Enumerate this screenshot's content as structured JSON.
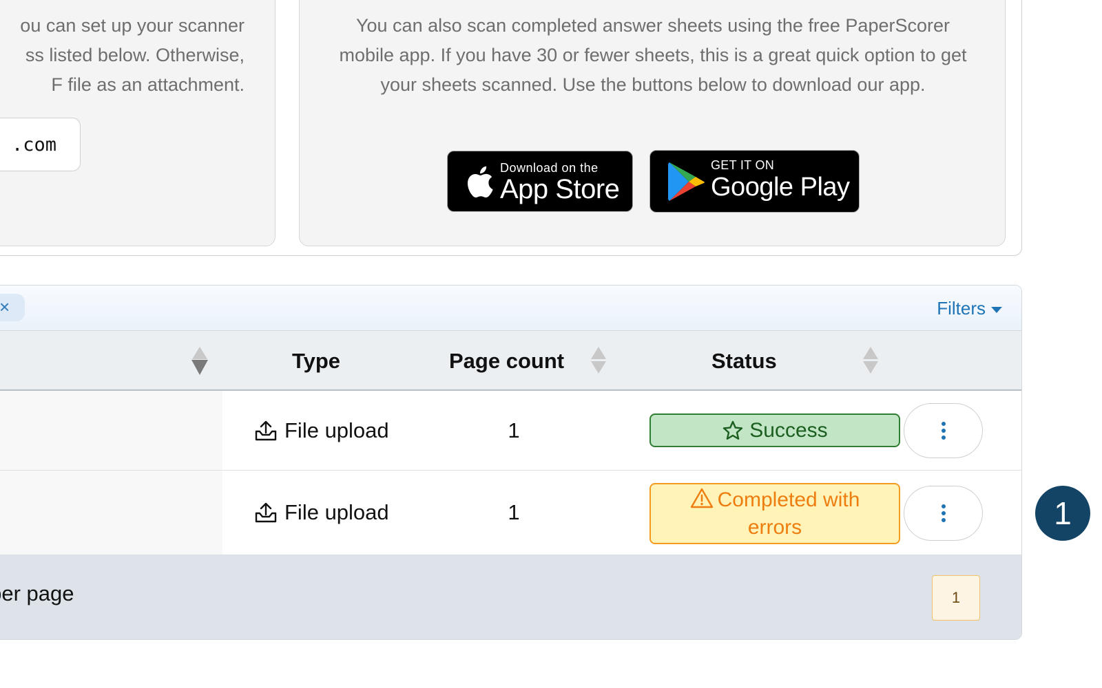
{
  "scanner_card": {
    "text_lines": [
      "ou can set up your scanner",
      "ss listed below. Otherwise,",
      "F file as an attachment."
    ],
    "email_fragment": ".com"
  },
  "mobile_card": {
    "description": "You can also scan completed answer sheets using the free PaperScorer mobile app. If you have 30 or fewer sheets, this is a great quick option to get your sheets scanned. Use the buttons below to download our app.",
    "app_store": {
      "small": "Download on the",
      "big": "App Store"
    },
    "google_play": {
      "small": "GET IT ON",
      "big": "Google Play"
    }
  },
  "toolbar": {
    "chip_close": "×",
    "filters_label": "Filters"
  },
  "table": {
    "columns": {
      "type": "Type",
      "page_count": "Page count",
      "status": "Status"
    },
    "rows": [
      {
        "type": "File upload",
        "page_count": "1",
        "status": "Success",
        "status_kind": "success"
      },
      {
        "type": "File upload",
        "page_count": "1",
        "status": "Completed with errors",
        "status_kind": "warning"
      }
    ],
    "footer": {
      "per_page_text": "s per page",
      "current_page": "1"
    }
  },
  "step_badge": "1",
  "colors": {
    "link_blue": "#1f74b6",
    "success_bg": "#c2e6c5",
    "success_border": "#2e7d32",
    "warning_bg": "#fff3b8",
    "warning_border": "#f29b1f",
    "step_badge_bg": "#134466"
  },
  "icons": [
    "apple-icon",
    "google-play-icon",
    "close-icon",
    "caret-down-icon",
    "sort-icon",
    "upload-icon",
    "star-icon",
    "warning-icon",
    "kebab-icon"
  ]
}
